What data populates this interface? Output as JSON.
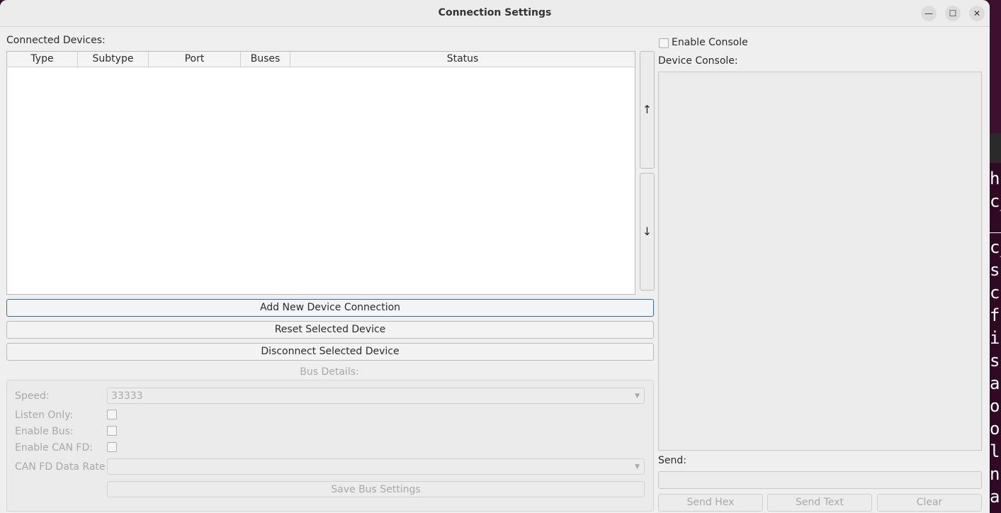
{
  "window": {
    "title": "Connection Settings"
  },
  "window_controls": {
    "minimize": "—",
    "maximize": "☐",
    "close": "✕"
  },
  "devices": {
    "label": "Connected Devices:",
    "columns": [
      "Type",
      "Subtype",
      "Port",
      "Buses",
      "Status"
    ],
    "rows": [],
    "move_up": "↑",
    "move_down": "↓"
  },
  "actions": {
    "add": "Add New Device Connection",
    "reset": "Reset Selected Device",
    "disconnect": "Disconnect Selected Device"
  },
  "bus_details": {
    "title": "Bus Details:",
    "speed_label": "Speed:",
    "speed_value": "33333",
    "listen_only_label": "Listen Only:",
    "listen_only_checked": false,
    "enable_bus_label": "Enable Bus:",
    "enable_bus_checked": false,
    "enable_canfd_label": "Enable CAN FD:",
    "enable_canfd_checked": false,
    "canfd_rate_label": "CAN FD Data Rate",
    "canfd_rate_value": "",
    "save": "Save Bus Settings"
  },
  "console": {
    "enable_label": "Enable Console",
    "enable_checked": false,
    "label": "Device Console:",
    "send_label": "Send:",
    "send_value": "",
    "send_hex": "Send Hex",
    "send_text": "Send Text",
    "clear": "Clear"
  },
  "background_terminal": {
    "lines": [
      "he",
      "c_",
      "c_",
      "se",
      "c",
      "f",
      "i",
      "s",
      "ac",
      "o",
      "o",
      "l",
      "n",
      "a"
    ]
  }
}
